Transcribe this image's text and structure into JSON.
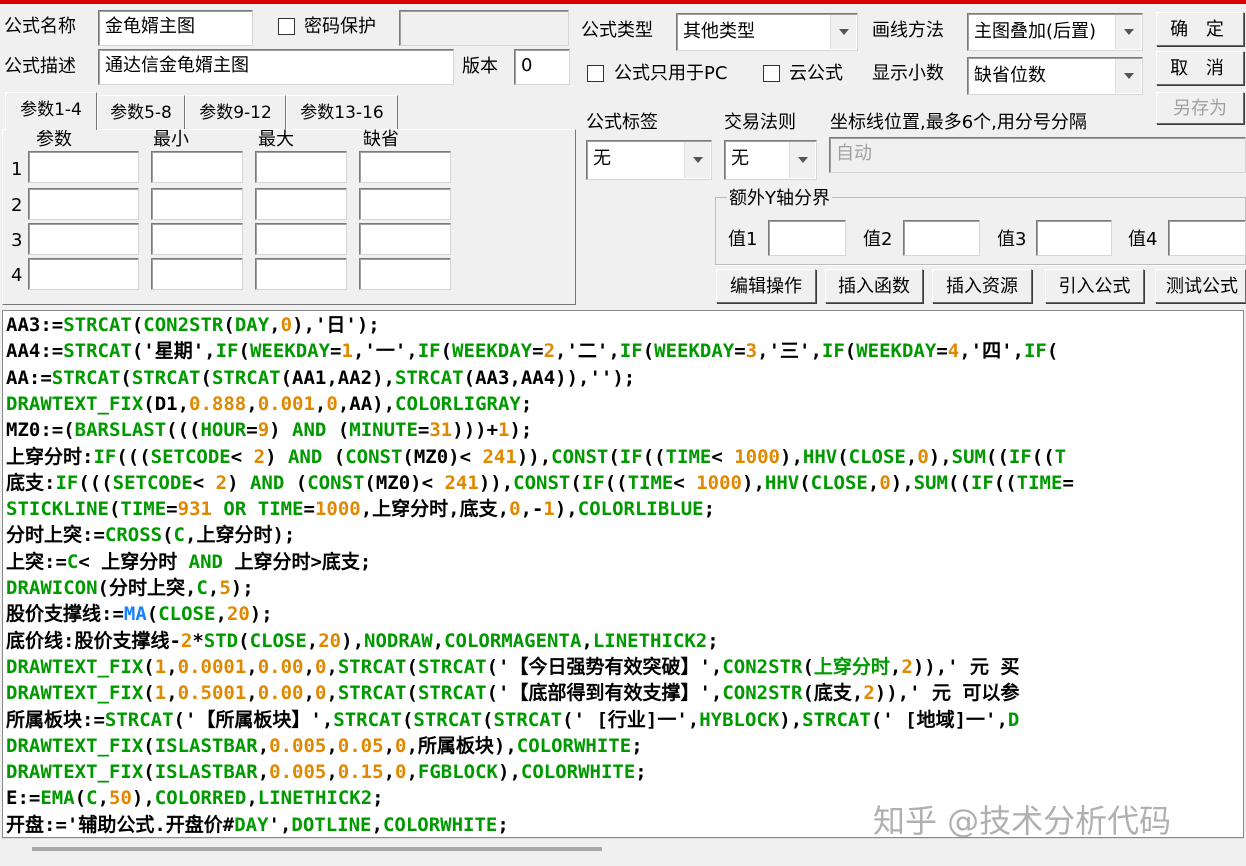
{
  "form": {
    "name_label": "公式名称",
    "name_value": "金龟婿主图",
    "password_label": "密码保护",
    "desc_label": "公式描述",
    "desc_value": "通达信金龟婿主图",
    "version_label": "版本",
    "version_value": "0",
    "type_label": "公式类型",
    "type_value": "其他类型",
    "draw_label": "画线方法",
    "draw_value": "主图叠加(后置)",
    "pc_only_label": "公式只用于PC",
    "cloud_label": "云公式",
    "decimals_label": "显示小数",
    "decimals_value": "缺省位数",
    "tag_label": "公式标签",
    "tag_value": "无",
    "trade_label": "交易法则",
    "trade_value": "无",
    "coord_label": "坐标线位置,最多6个,用分号分隔",
    "coord_placeholder": "自动",
    "yaxis_label": "额外Y轴分界",
    "val1": "值1",
    "val2": "值2",
    "val3": "值3",
    "val4": "值4"
  },
  "buttons": {
    "ok": "确 定",
    "cancel": "取 消",
    "save_as": "另存为",
    "edit_ops": "编辑操作",
    "insert_func": "插入函数",
    "insert_res": "插入资源",
    "import_formula": "引入公式",
    "test_formula": "测试公式"
  },
  "tabs": [
    "参数1-4",
    "参数5-8",
    "参数9-12",
    "参数13-16"
  ],
  "params": {
    "headers": [
      "参数",
      "最小",
      "最大",
      "缺省"
    ],
    "rows": [
      "1",
      "2",
      "3",
      "4"
    ]
  },
  "colors": {
    "default": "#000000",
    "func": "#009900",
    "num": "#e08800",
    "ma": "#1a7fff",
    "str": "#000000"
  },
  "code": [
    [
      [
        "d",
        "AA3:="
      ],
      [
        "f",
        "STRCAT"
      ],
      [
        "d",
        "("
      ],
      [
        "f",
        "CON2STR"
      ],
      [
        "d",
        "("
      ],
      [
        "f",
        "DAY"
      ],
      [
        "d",
        ","
      ],
      [
        "n",
        "0"
      ],
      [
        "d",
        "),'日');"
      ]
    ],
    [
      [
        "d",
        "AA4:="
      ],
      [
        "f",
        "STRCAT"
      ],
      [
        "d",
        "('星期',"
      ],
      [
        "f",
        "IF"
      ],
      [
        "d",
        "("
      ],
      [
        "f",
        "WEEKDAY"
      ],
      [
        "d",
        "="
      ],
      [
        "n",
        "1"
      ],
      [
        "d",
        ",'一',"
      ],
      [
        "f",
        "IF"
      ],
      [
        "d",
        "("
      ],
      [
        "f",
        "WEEKDAY"
      ],
      [
        "d",
        "="
      ],
      [
        "n",
        "2"
      ],
      [
        "d",
        ",'二',"
      ],
      [
        "f",
        "IF"
      ],
      [
        "d",
        "("
      ],
      [
        "f",
        "WEEKDAY"
      ],
      [
        "d",
        "="
      ],
      [
        "n",
        "3"
      ],
      [
        "d",
        ",'三',"
      ],
      [
        "f",
        "IF"
      ],
      [
        "d",
        "("
      ],
      [
        "f",
        "WEEKDAY"
      ],
      [
        "d",
        "="
      ],
      [
        "n",
        "4"
      ],
      [
        "d",
        ",'四',"
      ],
      [
        "f",
        "IF"
      ],
      [
        "d",
        "("
      ]
    ],
    [
      [
        "d",
        "AA:="
      ],
      [
        "f",
        "STRCAT"
      ],
      [
        "d",
        "("
      ],
      [
        "f",
        "STRCAT"
      ],
      [
        "d",
        "("
      ],
      [
        "f",
        "STRCAT"
      ],
      [
        "d",
        "(AA1,AA2),"
      ],
      [
        "f",
        "STRCAT"
      ],
      [
        "d",
        "(AA3,AA4)),'');"
      ]
    ],
    [
      [
        "f",
        "DRAWTEXT_FIX"
      ],
      [
        "d",
        "(D1,"
      ],
      [
        "n",
        "0.888"
      ],
      [
        "d",
        ","
      ],
      [
        "n",
        "0.001"
      ],
      [
        "d",
        ","
      ],
      [
        "n",
        "0"
      ],
      [
        "d",
        ",AA),"
      ],
      [
        "f",
        "COLORLIGRAY"
      ],
      [
        "d",
        ";"
      ]
    ],
    [
      [
        "d",
        "MZ0:=("
      ],
      [
        "f",
        "BARSLAST"
      ],
      [
        "d",
        "((("
      ],
      [
        "f",
        "HOUR"
      ],
      [
        "d",
        "="
      ],
      [
        "n",
        "9"
      ],
      [
        "d",
        ") "
      ],
      [
        "f",
        "AND"
      ],
      [
        "d",
        " ("
      ],
      [
        "f",
        "MINUTE"
      ],
      [
        "d",
        "="
      ],
      [
        "n",
        "31"
      ],
      [
        "d",
        ")))+"
      ],
      [
        "n",
        "1"
      ],
      [
        "d",
        ");"
      ]
    ],
    [
      [
        "d",
        "上穿分时:"
      ],
      [
        "f",
        "IF"
      ],
      [
        "d",
        "((("
      ],
      [
        "f",
        "SETCODE"
      ],
      [
        "d",
        "< "
      ],
      [
        "n",
        "2"
      ],
      [
        "d",
        ") "
      ],
      [
        "f",
        "AND"
      ],
      [
        "d",
        " ("
      ],
      [
        "f",
        "CONST"
      ],
      [
        "d",
        "(MZ0)< "
      ],
      [
        "n",
        "241"
      ],
      [
        "d",
        ")),"
      ],
      [
        "f",
        "CONST"
      ],
      [
        "d",
        "("
      ],
      [
        "f",
        "IF"
      ],
      [
        "d",
        "(("
      ],
      [
        "f",
        "TIME"
      ],
      [
        "d",
        "< "
      ],
      [
        "n",
        "1000"
      ],
      [
        "d",
        "),"
      ],
      [
        "f",
        "HHV"
      ],
      [
        "d",
        "("
      ],
      [
        "f",
        "CLOSE"
      ],
      [
        "d",
        ","
      ],
      [
        "n",
        "0"
      ],
      [
        "d",
        "),"
      ],
      [
        "f",
        "SUM"
      ],
      [
        "d",
        "(("
      ],
      [
        "f",
        "IF"
      ],
      [
        "d",
        "(("
      ],
      [
        "f",
        "T"
      ]
    ],
    [
      [
        "d",
        "底支:"
      ],
      [
        "f",
        "IF"
      ],
      [
        "d",
        "((("
      ],
      [
        "f",
        "SETCODE"
      ],
      [
        "d",
        "< "
      ],
      [
        "n",
        "2"
      ],
      [
        "d",
        ") "
      ],
      [
        "f",
        "AND"
      ],
      [
        "d",
        " ("
      ],
      [
        "f",
        "CONST"
      ],
      [
        "d",
        "(MZ0)< "
      ],
      [
        "n",
        "241"
      ],
      [
        "d",
        ")),"
      ],
      [
        "f",
        "CONST"
      ],
      [
        "d",
        "("
      ],
      [
        "f",
        "IF"
      ],
      [
        "d",
        "(("
      ],
      [
        "f",
        "TIME"
      ],
      [
        "d",
        "< "
      ],
      [
        "n",
        "1000"
      ],
      [
        "d",
        "),"
      ],
      [
        "f",
        "HHV"
      ],
      [
        "d",
        "("
      ],
      [
        "f",
        "CLOSE"
      ],
      [
        "d",
        ","
      ],
      [
        "n",
        "0"
      ],
      [
        "d",
        "),"
      ],
      [
        "f",
        "SUM"
      ],
      [
        "d",
        "(("
      ],
      [
        "f",
        "IF"
      ],
      [
        "d",
        "(("
      ],
      [
        "f",
        "TIME"
      ],
      [
        "d",
        "="
      ]
    ],
    [
      [
        "f",
        "STICKLINE"
      ],
      [
        "d",
        "("
      ],
      [
        "f",
        "TIME"
      ],
      [
        "d",
        "="
      ],
      [
        "n",
        "931"
      ],
      [
        "d",
        " "
      ],
      [
        "f",
        "OR"
      ],
      [
        "d",
        " "
      ],
      [
        "f",
        "TIME"
      ],
      [
        "d",
        "="
      ],
      [
        "n",
        "1000"
      ],
      [
        "d",
        ",上穿分时,底支,"
      ],
      [
        "n",
        "0"
      ],
      [
        "d",
        ",-"
      ],
      [
        "n",
        "1"
      ],
      [
        "d",
        "),"
      ],
      [
        "f",
        "COLORLIBLUE"
      ],
      [
        "d",
        ";"
      ]
    ],
    [
      [
        "d",
        "分时上突:="
      ],
      [
        "f",
        "CROSS"
      ],
      [
        "d",
        "("
      ],
      [
        "f",
        "C"
      ],
      [
        "d",
        ",上穿分时);"
      ]
    ],
    [
      [
        "d",
        "上突:="
      ],
      [
        "f",
        "C"
      ],
      [
        "d",
        "< 上穿分时 "
      ],
      [
        "f",
        "AND"
      ],
      [
        "d",
        " 上穿分时>底支;"
      ]
    ],
    [
      [
        "f",
        "DRAWICON"
      ],
      [
        "d",
        "(分时上突,"
      ],
      [
        "f",
        "C"
      ],
      [
        "d",
        ","
      ],
      [
        "n",
        "5"
      ],
      [
        "d",
        ");"
      ]
    ],
    [
      [
        "d",
        "股价支撑线:="
      ],
      [
        "m",
        "MA"
      ],
      [
        "d",
        "("
      ],
      [
        "f",
        "CLOSE"
      ],
      [
        "d",
        ","
      ],
      [
        "n",
        "20"
      ],
      [
        "d",
        ");"
      ]
    ],
    [
      [
        "d",
        "底价线:股价支撑线-"
      ],
      [
        "n",
        "2"
      ],
      [
        "d",
        "*"
      ],
      [
        "f",
        "STD"
      ],
      [
        "d",
        "("
      ],
      [
        "f",
        "CLOSE"
      ],
      [
        "d",
        ","
      ],
      [
        "n",
        "20"
      ],
      [
        "d",
        "),"
      ],
      [
        "f",
        "NODRAW"
      ],
      [
        "d",
        ","
      ],
      [
        "f",
        "COLORMAGENTA"
      ],
      [
        "d",
        ","
      ],
      [
        "f",
        "LINETHICK2"
      ],
      [
        "d",
        ";"
      ]
    ],
    [
      [
        "f",
        "DRAWTEXT_FIX"
      ],
      [
        "d",
        "("
      ],
      [
        "n",
        "1"
      ],
      [
        "d",
        ","
      ],
      [
        "n",
        "0.0001"
      ],
      [
        "d",
        ","
      ],
      [
        "n",
        "0.00"
      ],
      [
        "d",
        ","
      ],
      [
        "n",
        "0"
      ],
      [
        "d",
        ","
      ],
      [
        "f",
        "STRCAT"
      ],
      [
        "d",
        "("
      ],
      [
        "f",
        "STRCAT"
      ],
      [
        "d",
        "('【今日强势有效突破】',"
      ],
      [
        "f",
        "CON2STR"
      ],
      [
        "d",
        "("
      ],
      [
        "f",
        "上穿分时"
      ],
      [
        "d",
        ","
      ],
      [
        "n",
        "2"
      ],
      [
        "d",
        ")),' 元 买"
      ]
    ],
    [
      [
        "f",
        "DRAWTEXT_FIX"
      ],
      [
        "d",
        "("
      ],
      [
        "n",
        "1"
      ],
      [
        "d",
        ","
      ],
      [
        "n",
        "0.5001"
      ],
      [
        "d",
        ","
      ],
      [
        "n",
        "0.00"
      ],
      [
        "d",
        ","
      ],
      [
        "n",
        "0"
      ],
      [
        "d",
        ","
      ],
      [
        "f",
        "STRCAT"
      ],
      [
        "d",
        "("
      ],
      [
        "f",
        "STRCAT"
      ],
      [
        "d",
        "('【底部得到有效支撑】',"
      ],
      [
        "f",
        "CON2STR"
      ],
      [
        "d",
        "(底支,"
      ],
      [
        "n",
        "2"
      ],
      [
        "d",
        ")),' 元 可以参"
      ]
    ],
    [
      [
        "d",
        "所属板块:="
      ],
      [
        "f",
        "STRCAT"
      ],
      [
        "d",
        "('【所属板块】',"
      ],
      [
        "f",
        "STRCAT"
      ],
      [
        "d",
        "("
      ],
      [
        "f",
        "STRCAT"
      ],
      [
        "d",
        "("
      ],
      [
        "f",
        "STRCAT"
      ],
      [
        "d",
        "(' [行业]一',"
      ],
      [
        "f",
        "HYBLOCK"
      ],
      [
        "d",
        "),"
      ],
      [
        "f",
        "STRCAT"
      ],
      [
        "d",
        "(' [地域]一',"
      ],
      [
        "f",
        "D"
      ]
    ],
    [
      [
        "f",
        "DRAWTEXT_FIX"
      ],
      [
        "d",
        "("
      ],
      [
        "f",
        "ISLASTBAR"
      ],
      [
        "d",
        ","
      ],
      [
        "n",
        "0.005"
      ],
      [
        "d",
        ","
      ],
      [
        "n",
        "0.05"
      ],
      [
        "d",
        ","
      ],
      [
        "n",
        "0"
      ],
      [
        "d",
        ",所属板块),"
      ],
      [
        "f",
        "COLORWHITE"
      ],
      [
        "d",
        ";"
      ]
    ],
    [
      [
        "f",
        "DRAWTEXT_FIX"
      ],
      [
        "d",
        "("
      ],
      [
        "f",
        "ISLASTBAR"
      ],
      [
        "d",
        ","
      ],
      [
        "n",
        "0.005"
      ],
      [
        "d",
        ","
      ],
      [
        "n",
        "0.15"
      ],
      [
        "d",
        ","
      ],
      [
        "n",
        "0"
      ],
      [
        "d",
        ","
      ],
      [
        "f",
        "FGBLOCK"
      ],
      [
        "d",
        "),"
      ],
      [
        "f",
        "COLORWHITE"
      ],
      [
        "d",
        ";"
      ]
    ],
    [
      [
        "d",
        "E:="
      ],
      [
        "f",
        "EMA"
      ],
      [
        "d",
        "("
      ],
      [
        "f",
        "C"
      ],
      [
        "d",
        ","
      ],
      [
        "n",
        "50"
      ],
      [
        "d",
        "),"
      ],
      [
        "f",
        "COLORRED"
      ],
      [
        "d",
        ","
      ],
      [
        "f",
        "LINETHICK2"
      ],
      [
        "d",
        ";"
      ]
    ],
    [
      [
        "d",
        "开盘:='辅助公式.开盘价#"
      ],
      [
        "f",
        "DAY"
      ],
      [
        "d",
        "',"
      ],
      [
        "f",
        "DOTLINE"
      ],
      [
        "d",
        ","
      ],
      [
        "f",
        "COLORWHITE"
      ],
      [
        "d",
        ";"
      ]
    ]
  ],
  "watermark": "知乎 @技术分析代码"
}
